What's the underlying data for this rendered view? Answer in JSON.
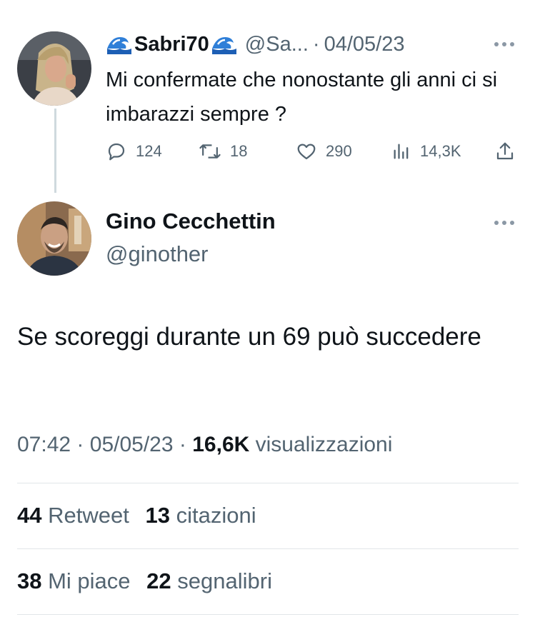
{
  "tweet1": {
    "emoji": "🌊",
    "display_name": "Sabri70",
    "handle": "@Sa...",
    "separator": "·",
    "date": "04/05/23",
    "text": "Mi confermate che nonostante gli anni ci si imbarazzi sempre ?",
    "replies": "124",
    "retweets": "18",
    "likes": "290",
    "views": "14,3K"
  },
  "tweet2": {
    "display_name": "Gino Cecchettin",
    "handle": "@ginother",
    "text": "Se scoreggi durante un 69 può succedere",
    "time": "07:42",
    "sep": "·",
    "date": "05/05/23",
    "views_count": "16,6K",
    "views_label": "visualizzazioni",
    "stats": {
      "retweets_count": "44",
      "retweets_label": "Retweet",
      "quotes_count": "13",
      "quotes_label": "citazioni",
      "likes_count": "38",
      "likes_label": "Mi piace",
      "bookmarks_count": "22",
      "bookmarks_label": "segnalibri"
    }
  },
  "icons": [
    "wave-emoji-icon",
    "more-icon",
    "reply-icon",
    "retweet-icon",
    "like-icon",
    "views-icon",
    "share-icon"
  ],
  "colors": {
    "text": "#0f1419",
    "secondary": "#536471",
    "divider": "#e1e6e9",
    "thread_line": "#cfd9de"
  }
}
